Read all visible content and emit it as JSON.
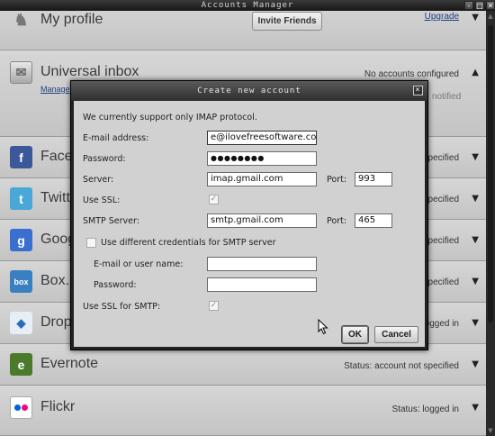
{
  "window": {
    "title": "Accounts Manager",
    "buttons": {
      "minimize": "-",
      "restore": "□",
      "close": "✕"
    }
  },
  "profile": {
    "name": "My profile",
    "invite_label": "Invite Friends",
    "upgrade_label": "Upgrade"
  },
  "inbox": {
    "name": "Universal inbox",
    "status": "No accounts configured",
    "manage_label": "Manage",
    "notified_text": "notified"
  },
  "services": [
    {
      "name": "Facebook",
      "status": "Status: account not specified",
      "icon": "facebook-icon",
      "icon_char": "f",
      "color": "#3b5998"
    },
    {
      "name": "Twitter",
      "status": "Status: account not specified",
      "icon": "twitter-icon",
      "icon_char": "t",
      "color": "#4aa8d8"
    },
    {
      "name": "Google",
      "status": "Status: account not specified",
      "icon": "google-icon",
      "icon_char": "g",
      "color": "#3a6fd0"
    },
    {
      "name": "Box.net",
      "status": "Status: account not specified",
      "icon": "box-icon",
      "icon_char": "box",
      "color": "#3a7fc0"
    },
    {
      "name": "Dropbox",
      "status": "Status: logged in",
      "icon": "dropbox-icon",
      "icon_char": "◆",
      "color": "#2a6db7"
    },
    {
      "name": "Evernote",
      "status": "Status: account not specified",
      "icon": "evernote-icon",
      "icon_char": "e",
      "color": "#4a7a2a"
    },
    {
      "name": "Flickr",
      "status": "Status: logged in",
      "icon": "flickr-icon",
      "icon_char": "●●",
      "color": "#ffffff"
    }
  ],
  "visible_fragments": {
    "facebook": "Face",
    "twitter": "Twitt",
    "google": "Goog",
    "box": "Box.",
    "dropbox": "Drop",
    "status_not_specified": "pecified",
    "status_logged": "logged in"
  },
  "dialog": {
    "title": "Create new account",
    "intro": "We currently support only IMAP protocol.",
    "email_label": "E-mail address:",
    "email_value": "e@ilovefreesoftware.com",
    "password_label": "Password:",
    "password_value": "●●●●●●●●",
    "server_label": "Server:",
    "server_value": "imap.gmail.com",
    "port_label": "Port:",
    "port_value": "993",
    "ssl_label": "Use SSL:",
    "smtp_server_label": "SMTP Server:",
    "smtp_server_value": "smtp.gmail.com",
    "smtp_port_label": "Port:",
    "smtp_port_value": "465",
    "diff_creds_label": "Use different credentials for SMTP server",
    "smtp_user_label": "E-mail or user name:",
    "smtp_user_value": "",
    "smtp_password_label": "Password:",
    "smtp_password_value": "",
    "ssl_smtp_label": "Use SSL for SMTP:",
    "ok_label": "OK",
    "cancel_label": "Cancel",
    "close_label": "×",
    "check_mark": "✓"
  }
}
